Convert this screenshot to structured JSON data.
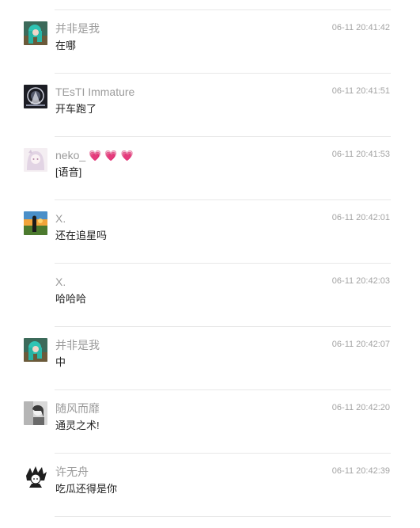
{
  "messages": [
    {
      "name": "并非是我",
      "decor": "",
      "time": "06-11 20:41:42",
      "text": "在哪",
      "avatar": "teal-hair-avatar"
    },
    {
      "name": "TEsTI Immature",
      "decor": "",
      "time": "06-11 20:41:51",
      "text": "开车跑了",
      "avatar": "dark-emblem-avatar"
    },
    {
      "name": "neko_",
      "decor": "💗💗💗",
      "time": "06-11 20:41:53",
      "text": "[语音]",
      "avatar": "pale-anime-avatar"
    },
    {
      "name": "X.",
      "decor": "",
      "time": "06-11 20:42:01",
      "text": "还在追星吗",
      "avatar": "sunset-figure-avatar"
    },
    {
      "name": "X.",
      "decor": "",
      "time": "06-11 20:42:03",
      "text": "哈哈哈",
      "avatar": ""
    },
    {
      "name": "并非是我",
      "decor": "",
      "time": "06-11 20:42:07",
      "text": "中",
      "avatar": "teal-hair-avatar"
    },
    {
      "name": "随风而靡",
      "decor": "",
      "time": "06-11 20:42:20",
      "text": "通灵之术!",
      "avatar": "grayscale-portrait-avatar"
    },
    {
      "name": "许无舟",
      "decor": "",
      "time": "06-11 20:42:39",
      "text": "吃瓜还得是你",
      "avatar": "manga-character-avatar"
    }
  ]
}
